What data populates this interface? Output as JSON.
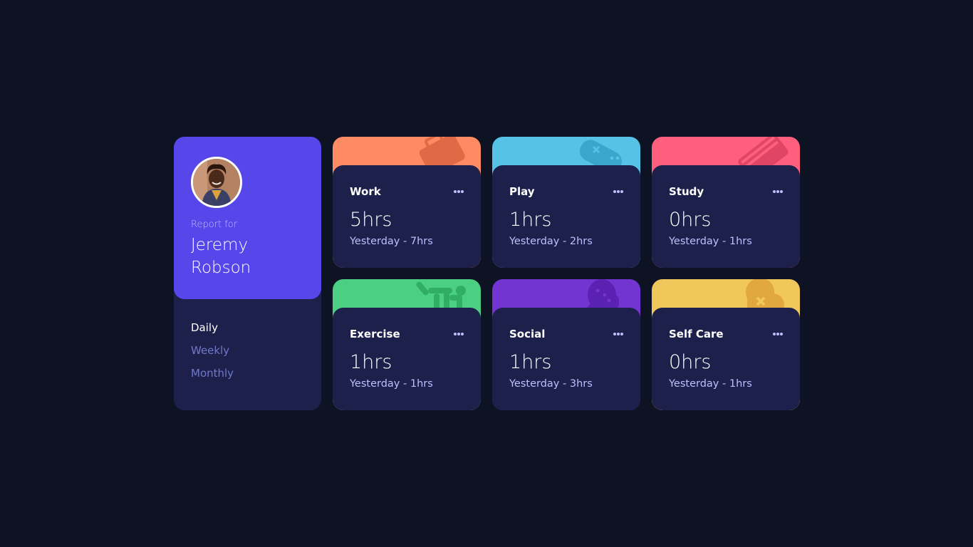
{
  "profile": {
    "report_label": "Report for",
    "name": "Jeremy Robson",
    "avatar_icon": "person-avatar",
    "periods": [
      {
        "label": "Daily",
        "active": true
      },
      {
        "label": "Weekly",
        "active": false
      },
      {
        "label": "Monthly",
        "active": false
      }
    ]
  },
  "colors": {
    "background": "#0e1323",
    "card": "#1c204b",
    "profile": "#5746ea",
    "muted_text": "#bbc0ff",
    "period_inactive": "#7078c9"
  },
  "activities": [
    {
      "title": "Work",
      "current": "5hrs",
      "previous": "Yesterday - 7hrs",
      "color": "#ff8b64",
      "icon": "briefcase-icon"
    },
    {
      "title": "Play",
      "current": "1hrs",
      "previous": "Yesterday - 2hrs",
      "color": "#55c2e6",
      "icon": "gamepad-icon"
    },
    {
      "title": "Study",
      "current": "0hrs",
      "previous": "Yesterday - 1hrs",
      "color": "#ff5e7d",
      "icon": "books-icon"
    },
    {
      "title": "Exercise",
      "current": "1hrs",
      "previous": "Yesterday - 1hrs",
      "color": "#4bcf82",
      "icon": "running-person-icon"
    },
    {
      "title": "Social",
      "current": "1hrs",
      "previous": "Yesterday - 3hrs",
      "color": "#7335d2",
      "icon": "chat-bubble-icon"
    },
    {
      "title": "Self Care",
      "current": "0hrs",
      "previous": "Yesterday - 1hrs",
      "color": "#f1c75b",
      "icon": "heart-icon"
    }
  ]
}
